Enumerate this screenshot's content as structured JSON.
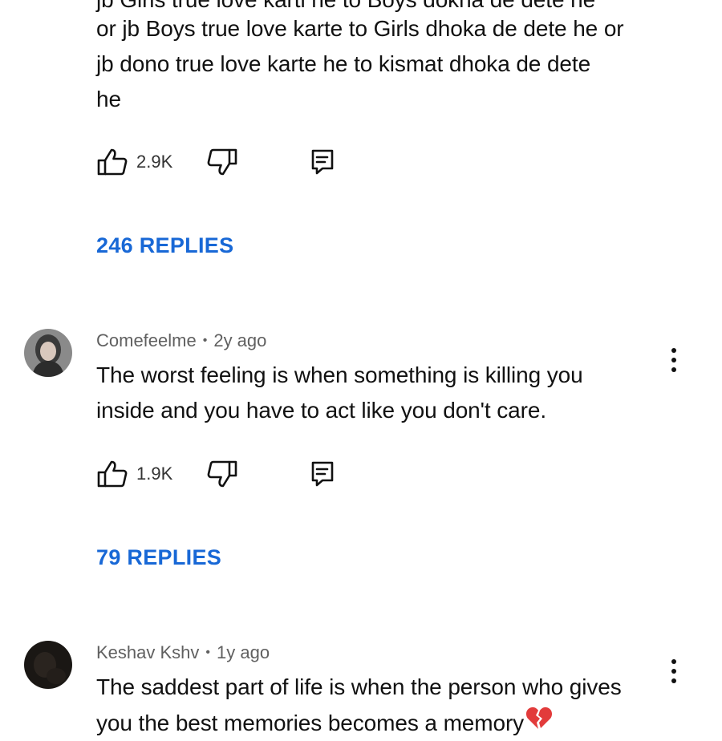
{
  "comment1": {
    "partial_line": "jb Girls true love karti he to Boys dokha de dete he",
    "lines": [
      "or jb Boys true love karte to Girls dhoka de dete he or",
      "jb dono true love karte he to kismat dhoka de dete",
      "he"
    ],
    "likes": "2.9K",
    "replies": "246 REPLIES"
  },
  "comment2": {
    "author": "Comefeelme",
    "separator": "•",
    "age": "2y ago",
    "lines": [
      "The worst feeling is when something is killing you",
      "inside and you have to act like you don't care."
    ],
    "likes": "1.9K",
    "replies": "79 REPLIES"
  },
  "comment3": {
    "author": "Keshav Kshv",
    "separator": "•",
    "age": "1y ago",
    "lines": [
      "The saddest part of life is when the person who gives",
      "you the best memories becomes a memory"
    ]
  },
  "icons": {
    "like": "thumbs-up-icon",
    "dislike": "thumbs-down-icon",
    "reply": "reply-comment-icon",
    "more": "more-vertical-icon",
    "broken_heart": "broken-heart-emoji"
  },
  "colors": {
    "link_blue": "#1868d6",
    "meta_gray": "#606060",
    "text": "#111111",
    "broken_heart": "#e23b3b"
  }
}
